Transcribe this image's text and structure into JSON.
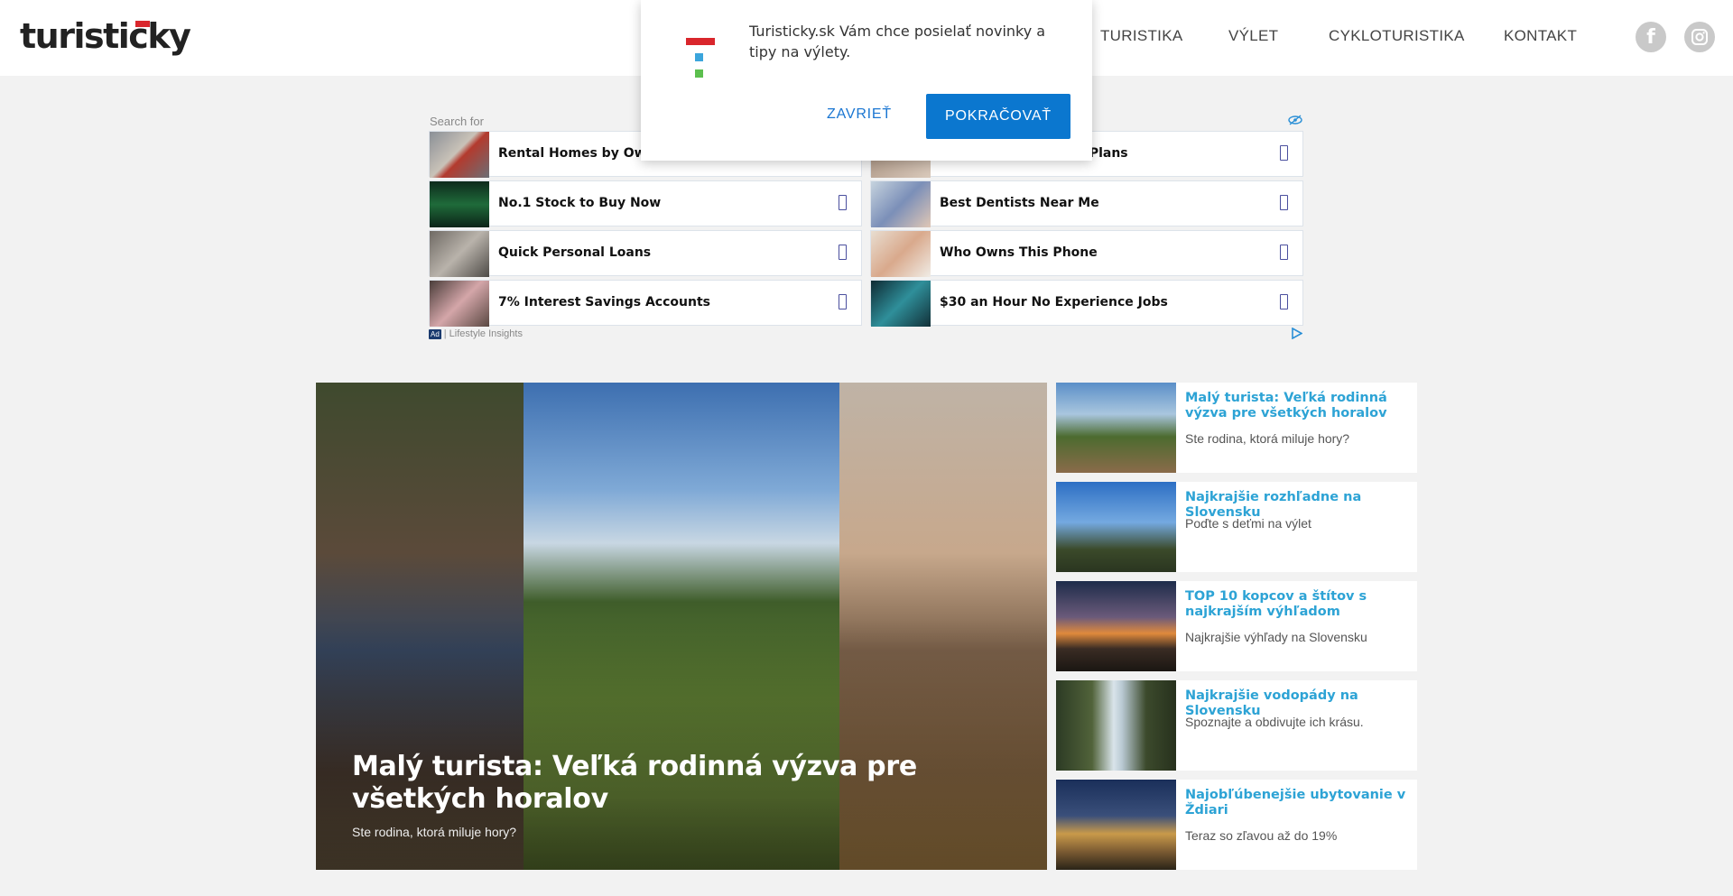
{
  "header": {
    "logo": "turisticky",
    "nav": [
      "TURISTIKA",
      "VÝLET",
      "CYKLOTURISTIKA",
      "KONTAKT"
    ],
    "social": [
      {
        "icon": "facebook-icon",
        "glyph": "f"
      },
      {
        "icon": "instagram-icon",
        "glyph": ""
      }
    ]
  },
  "popup": {
    "message": "Turisticky.sk Vám chce posielať novinky a tipy na výlety.",
    "close_label": "ZAVRIEŤ",
    "continue_label": "POKRAČOVAŤ"
  },
  "ad": {
    "search_label": "Search for",
    "items": [
      {
        "label": "Rental Homes by Owner"
      },
      {
        "label": "age Plans"
      },
      {
        "label": "No.1 Stock to Buy Now"
      },
      {
        "label": "Best Dentists Near Me"
      },
      {
        "label": "Quick Personal Loans"
      },
      {
        "label": "Who Owns This Phone"
      },
      {
        "label": "7% Interest Savings Accounts"
      },
      {
        "label": "$30 an Hour No Experience Jobs"
      }
    ],
    "badge": "Ad",
    "provider": "Lifestyle Insights"
  },
  "hero": {
    "title": "Malý turista: Veľká rodinná výzva pre všetkých horalov",
    "subtitle": "Ste rodina, ktorá miluje hory?"
  },
  "articles": [
    {
      "title": "Malý turista: Veľká rodinná výzva pre všetkých horalov",
      "subtitle": "Ste rodina, ktorá miluje hory?"
    },
    {
      "title": "Najkrajšie rozhľadne na Slovensku",
      "subtitle": "Poďte s deťmi na výlet"
    },
    {
      "title": "TOP 10 kopcov a štítov s najkrajším výhľadom",
      "subtitle": "Najkrajšie výhľady na Slovensku"
    },
    {
      "title": "Najkrajšie vodopády na Slovensku",
      "subtitle": "Spoznajte a obdivujte ich krásu."
    },
    {
      "title": "Najobľúbenejšie ubytovanie v Ždiari",
      "subtitle": "Teraz so zľavou až do 19%"
    }
  ],
  "colors": {
    "accent": "#2da3d5",
    "brand_red": "#d9262c",
    "button_blue": "#0b77cf"
  }
}
